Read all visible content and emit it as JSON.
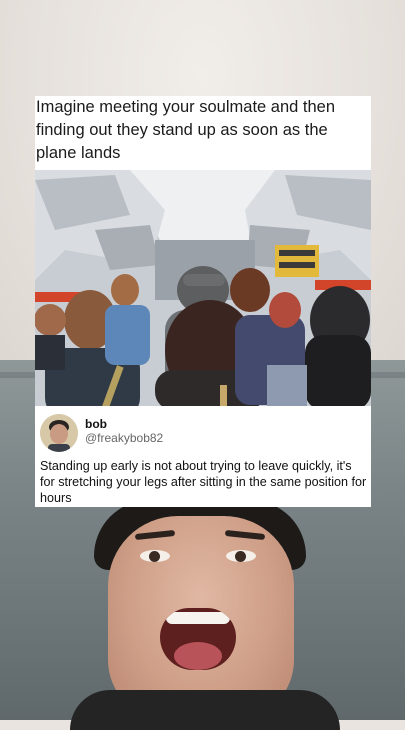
{
  "meme": {
    "caption": "Imagine meeting your soulmate and then finding out they stand up as soon as the plane lands"
  },
  "tweet": {
    "name": "bob",
    "handle": "@freakybob82",
    "text": "Standing up early is not about trying to leave quickly, it's for stretching your legs after sitting in the same position for hours"
  },
  "colors": {
    "cabin_stripe": "#d2452b",
    "couch": "#7b8587",
    "text": "#1b1b1b"
  }
}
